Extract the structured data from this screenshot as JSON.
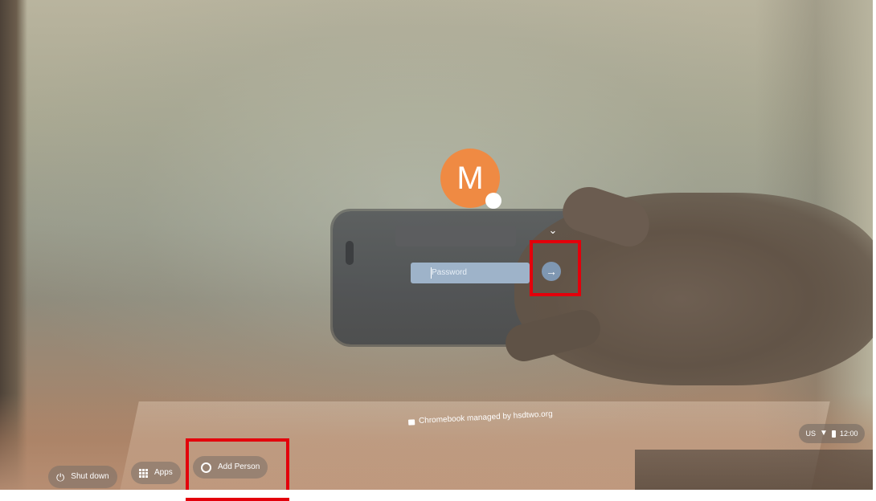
{
  "login": {
    "avatar_initial": "M",
    "password_placeholder": "Password",
    "chevron_glyph": "⌄",
    "submit_glyph": "→"
  },
  "notice": {
    "managed_text": "Chromebook managed by hsdtwo.org"
  },
  "shelf": {
    "shutdown_label": "Shut down",
    "apps_label": "Apps",
    "add_person_label": "Add Person"
  },
  "tray": {
    "locale": "US",
    "time": "12:00"
  },
  "colors": {
    "avatar": "#ef8a43",
    "highlight": "#e3000b",
    "password_field": "#9eb3c9"
  },
  "icons": [
    "power-icon",
    "apps-icon",
    "add-person-icon",
    "wifi-icon",
    "battery-icon",
    "arrow-right-icon",
    "chevron-down-icon",
    "building-icon"
  ]
}
